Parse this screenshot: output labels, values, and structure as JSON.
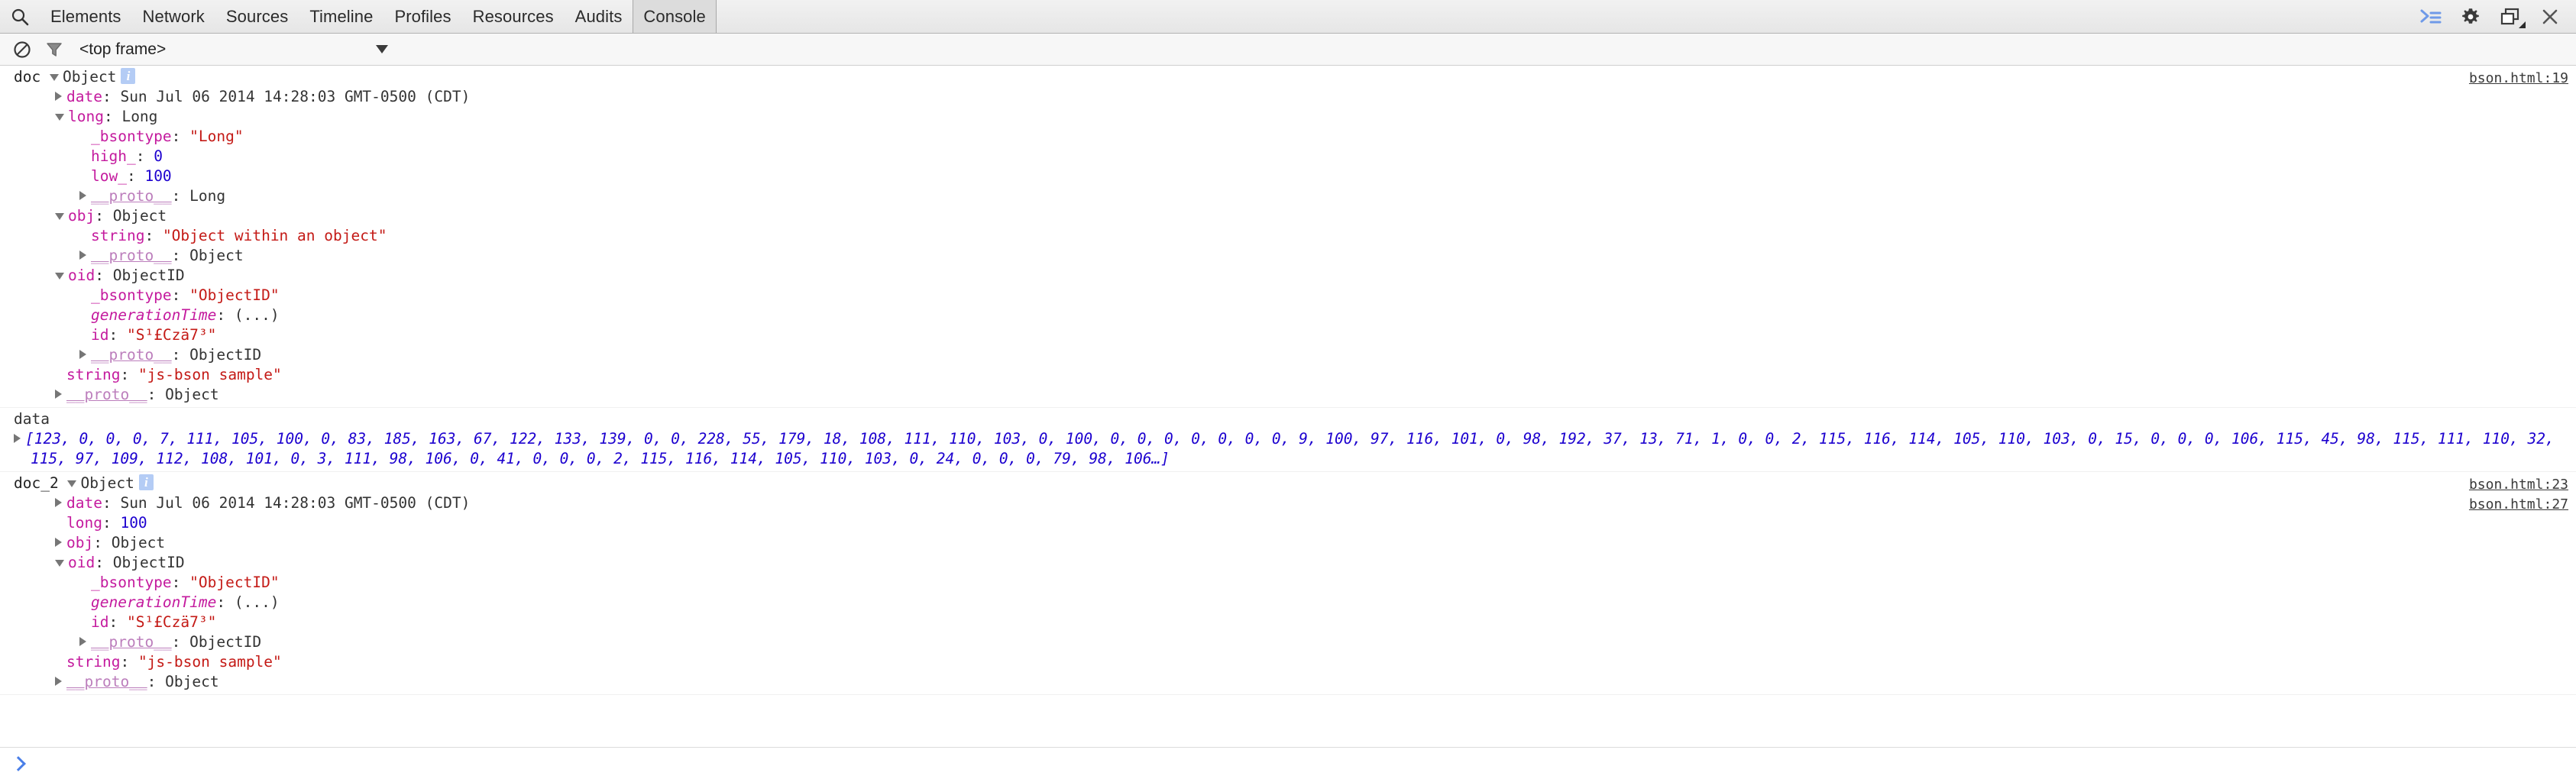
{
  "toolbar": {
    "search_icon": "search-icon",
    "tabs": [
      {
        "label": "Elements",
        "selected": false
      },
      {
        "label": "Network",
        "selected": false
      },
      {
        "label": "Sources",
        "selected": false
      },
      {
        "label": "Timeline",
        "selected": false
      },
      {
        "label": "Profiles",
        "selected": false
      },
      {
        "label": "Resources",
        "selected": false
      },
      {
        "label": "Audits",
        "selected": false
      },
      {
        "label": "Console",
        "selected": true
      }
    ],
    "right_icons": [
      {
        "name": "console-drawer-icon",
        "glyph": "≫"
      },
      {
        "name": "gear-icon",
        "glyph": "⚙"
      },
      {
        "name": "dock-position-icon",
        "glyph": "⧉"
      },
      {
        "name": "close-icon",
        "glyph": "✕"
      }
    ],
    "accent_blue": "#6f9ae8"
  },
  "filter_bar": {
    "clear_console_icon": "clear-console-icon",
    "filter_icon": "filter-funnel-icon",
    "context_value": "<top frame>",
    "context_caret": "chevron-down-icon"
  },
  "console": {
    "groups": [
      {
        "id": "doc",
        "label": "doc",
        "type": "Object",
        "badge": "i",
        "link": [
          "bson.html:19"
        ],
        "lines": [
          {
            "indent": 1,
            "tri": "right",
            "prop": "date",
            "sep": ": ",
            "value": "Sun Jul 06 2014 14:28:03 GMT-0500 (CDT)",
            "vclass": "plain"
          },
          {
            "indent": 1,
            "tri": "down",
            "prop": "long",
            "sep": ": ",
            "value": "Long",
            "vclass": "plain"
          },
          {
            "indent": 2,
            "tri": "none",
            "prop": "_bsontype",
            "sep": ": ",
            "value": "\"Long\"",
            "vclass": "str"
          },
          {
            "indent": 2,
            "tri": "none",
            "prop": "high_",
            "sep": ": ",
            "value": "0",
            "vclass": "num"
          },
          {
            "indent": 2,
            "tri": "none",
            "prop": "low_",
            "sep": ": ",
            "value": "100",
            "vclass": "num"
          },
          {
            "indent": 2,
            "tri": "right",
            "prop": "__proto__",
            "sep": ": ",
            "value": "Long",
            "vclass": "plain",
            "pclass": "proto"
          },
          {
            "indent": 1,
            "tri": "down",
            "prop": "obj",
            "sep": ": ",
            "value": "Object",
            "vclass": "plain"
          },
          {
            "indent": 2,
            "tri": "none",
            "prop": "string",
            "sep": ": ",
            "value": "\"Object within an object\"",
            "vclass": "str"
          },
          {
            "indent": 2,
            "tri": "right",
            "prop": "__proto__",
            "sep": ": ",
            "value": "Object",
            "vclass": "plain",
            "pclass": "proto"
          },
          {
            "indent": 1,
            "tri": "down",
            "prop": "oid",
            "sep": ": ",
            "value": "ObjectID",
            "vclass": "plain"
          },
          {
            "indent": 2,
            "tri": "none",
            "prop": "_bsontype",
            "sep": ": ",
            "value": "\"ObjectID\"",
            "vclass": "str"
          },
          {
            "indent": 2,
            "tri": "none",
            "prop": "generationTime",
            "sep": ": ",
            "value": "(...)",
            "vclass": "plain",
            "pclass": "prop ital"
          },
          {
            "indent": 2,
            "tri": "none",
            "prop": "id",
            "sep": ": ",
            "value": "\"S¹£Czä7³\"",
            "vclass": "str"
          },
          {
            "indent": 2,
            "tri": "right",
            "prop": "__proto__",
            "sep": ": ",
            "value": "ObjectID",
            "vclass": "plain",
            "pclass": "proto"
          },
          {
            "indent": 1,
            "tri": "none",
            "prop": "string",
            "sep": ": ",
            "value": "\"js-bson sample\"",
            "vclass": "str"
          },
          {
            "indent": 1,
            "tri": "right",
            "prop": "__proto__",
            "sep": ": ",
            "value": "Object",
            "vclass": "plain",
            "pclass": "proto"
          }
        ]
      },
      {
        "id": "data",
        "label": "data",
        "type": "array",
        "link": [],
        "array_text": "[123, 0, 0, 0, 7, 111, 105, 100, 0, 83, 185, 163, 67, 122, 133, 139, 0, 0, 228, 55, 179, 18, 108, 111, 110, 103, 0, 100, 0, 0, 0, 0, 0, 0, 0, 9, 100, 97, 116, 101, 0, 98, 192, 37, 13, 71, 1, 0, 0, 2, 115, 116, 114, 105, 110, 103, 0, 15, 0, 0, 0, 106, 115, 45, 98, 115, 111, 110, 32, 115, 97, 109, 112, 108, 101, 0, 3, 111, 98, 106, 0, 41, 0, 0, 0, 2, 115, 116, 114, 105, 110, 103, 0, 24, 0, 0, 0, 79, 98, 106…]"
      },
      {
        "id": "doc_2",
        "label": "doc_2",
        "type": "Object",
        "badge": "i",
        "link": [
          "bson.html:23",
          "bson.html:27"
        ],
        "lines": [
          {
            "indent": 1,
            "tri": "right",
            "prop": "date",
            "sep": ": ",
            "value": "Sun Jul 06 2014 14:28:03 GMT-0500 (CDT)",
            "vclass": "plain"
          },
          {
            "indent": 1,
            "tri": "none",
            "prop": "long",
            "sep": ": ",
            "value": "100",
            "vclass": "num"
          },
          {
            "indent": 1,
            "tri": "right",
            "prop": "obj",
            "sep": ": ",
            "value": "Object",
            "vclass": "plain"
          },
          {
            "indent": 1,
            "tri": "down",
            "prop": "oid",
            "sep": ": ",
            "value": "ObjectID",
            "vclass": "plain"
          },
          {
            "indent": 2,
            "tri": "none",
            "prop": "_bsontype",
            "sep": ": ",
            "value": "\"ObjectID\"",
            "vclass": "str"
          },
          {
            "indent": 2,
            "tri": "none",
            "prop": "generationTime",
            "sep": ": ",
            "value": "(...)",
            "vclass": "plain",
            "pclass": "prop ital"
          },
          {
            "indent": 2,
            "tri": "none",
            "prop": "id",
            "sep": ": ",
            "value": "\"S¹£Czä7³\"",
            "vclass": "str"
          },
          {
            "indent": 2,
            "tri": "right",
            "prop": "__proto__",
            "sep": ": ",
            "value": "ObjectID",
            "vclass": "plain",
            "pclass": "proto"
          },
          {
            "indent": 1,
            "tri": "none",
            "prop": "string",
            "sep": ": ",
            "value": "\"js-bson sample\"",
            "vclass": "str"
          },
          {
            "indent": 1,
            "tri": "right",
            "prop": "__proto__",
            "sep": ": ",
            "value": "Object",
            "vclass": "plain",
            "pclass": "proto"
          }
        ]
      }
    ]
  },
  "prompt": {
    "chevron": "prompt-chevron-icon",
    "value": "",
    "placeholder": ""
  }
}
